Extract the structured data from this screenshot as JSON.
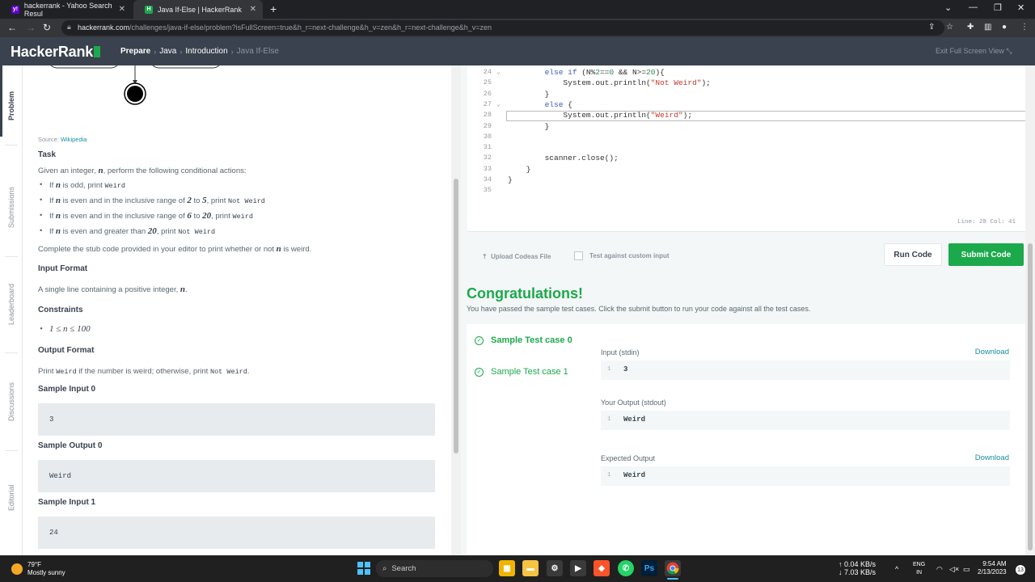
{
  "browser": {
    "tabs": [
      {
        "title": "hackerrank - Yahoo Search Resul",
        "favicon": "y!"
      },
      {
        "title": "Java If-Else | HackerRank",
        "favicon": "H"
      }
    ],
    "url_domain": "hackerrank.com",
    "url_path": "/challenges/java-if-else/problem?isFullScreen=true&h_r=next-challenge&h_v=zen&h_r=next-challenge&h_v=zen"
  },
  "header": {
    "logo": "HackerRank",
    "crumbs": [
      "Prepare",
      "Java",
      "Introduction",
      "Java If-Else"
    ],
    "exit_fullscreen": "Exit Full Screen View"
  },
  "sidetabs": [
    "Problem",
    "Submissions",
    "Leaderboard",
    "Discussions",
    "Editorial"
  ],
  "problem": {
    "source_label": "Source:",
    "source_link": "Wikipedia",
    "task_heading": "Task",
    "task_intro": "Given an integer, n, perform the following conditional actions:",
    "rules": [
      {
        "pre": "If ",
        "var": "n",
        "mid": " is odd, print ",
        "code": "Weird"
      },
      {
        "pre": "If ",
        "var": "n",
        "mid": " is even and in the inclusive range of 2 to 5, print ",
        "code": "Not Weird"
      },
      {
        "pre": "If ",
        "var": "n",
        "mid": " is even and in the inclusive range of 6 to 20, print ",
        "code": "Weird"
      },
      {
        "pre": "If ",
        "var": "n",
        "mid": " is even and greater than 20, print ",
        "code": "Not Weird"
      }
    ],
    "complete_text": "Complete the stub code provided in your editor to print whether or not n is weird.",
    "input_heading": "Input Format",
    "input_text": "A single line containing a positive integer, n.",
    "constraints_heading": "Constraints",
    "constraint": "1 ≤ n ≤ 100",
    "output_heading": "Output Format",
    "output_pre": "Print ",
    "output_code1": "Weird",
    "output_mid": " if the number is weird; otherwise, print ",
    "output_code2": "Not Weird",
    "output_end": ".",
    "sample_input0_heading": "Sample Input 0",
    "sample_input0": "3",
    "sample_output0_heading": "Sample Output 0",
    "sample_output0": "Weird",
    "sample_input1_heading": "Sample Input 1",
    "sample_input1": "24"
  },
  "editor": {
    "lines": [
      {
        "n": "24",
        "fold": "v",
        "text": "        else if (N%2==0 && N>=20){"
      },
      {
        "n": "25",
        "fold": "",
        "text": "            System.out.println(\"Not Weird\");"
      },
      {
        "n": "26",
        "fold": "",
        "text": "        }"
      },
      {
        "n": "27",
        "fold": "v",
        "text": "        else {"
      },
      {
        "n": "28",
        "fold": "",
        "text": "            System.out.println(\"Weird\");"
      },
      {
        "n": "29",
        "fold": "",
        "text": "        }"
      },
      {
        "n": "30",
        "fold": "",
        "text": ""
      },
      {
        "n": "31",
        "fold": "",
        "text": ""
      },
      {
        "n": "32",
        "fold": "",
        "text": "        scanner.close();"
      },
      {
        "n": "33",
        "fold": "",
        "text": "    }"
      },
      {
        "n": "34",
        "fold": "",
        "text": "}"
      },
      {
        "n": "35",
        "fold": "",
        "text": ""
      }
    ],
    "status": "Line: 28 Col: 41"
  },
  "actions": {
    "upload": "Upload Codeas File",
    "custom_input": "Test against custom input",
    "run": "Run Code",
    "submit": "Submit Code"
  },
  "result": {
    "title": "Congratulations!",
    "subtitle": "You have passed the sample test cases. Click the submit button to run your code against all the test cases.",
    "testcases": [
      "Sample Test case 0",
      "Sample Test case 1"
    ],
    "input_label": "Input (stdin)",
    "download": "Download",
    "input_value": "3",
    "your_output_label": "Your Output (stdout)",
    "your_output_value": "Weird",
    "expected_label": "Expected Output",
    "expected_value": "Weird",
    "line_no": "1"
  },
  "taskbar": {
    "temp": "79°F",
    "weather": "Mostly sunny",
    "search": "Search",
    "net_up": "↑ 0.04 KB/s",
    "net_down": "↓ 7.03 KB/s",
    "lang1": "ENG",
    "lang2": "IN",
    "time": "9:54 AM",
    "date": "2/13/2023",
    "notif": "13"
  },
  "colors": {
    "accent": "#1ba94c",
    "header": "#39424e",
    "link": "#1a8ea2"
  }
}
